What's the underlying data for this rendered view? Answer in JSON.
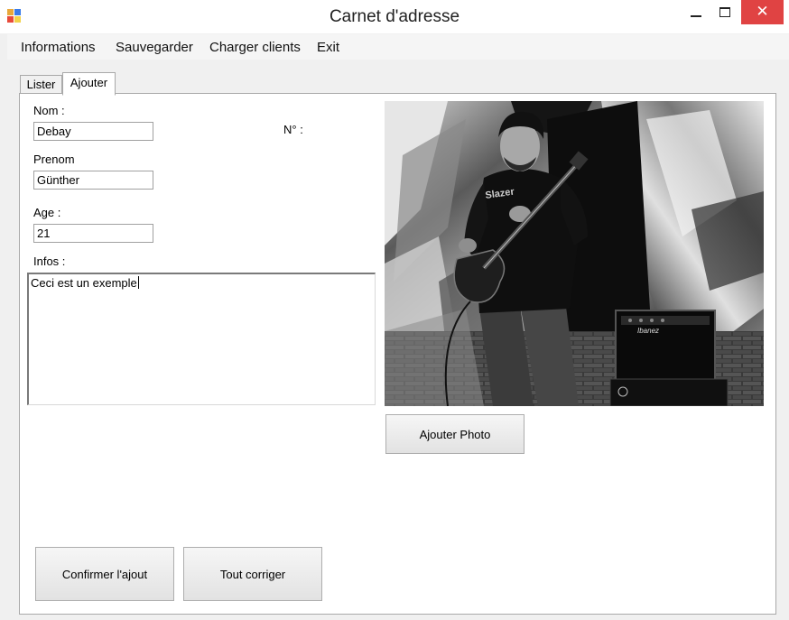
{
  "window": {
    "title": "Carnet d'adresse",
    "close_symbol": "✕",
    "icons": [
      "app-icon",
      "minimize-icon",
      "maximize-icon",
      "close-icon"
    ]
  },
  "menu": {
    "items": [
      "Informations",
      "Sauvegarder",
      "Charger clients",
      "Exit"
    ]
  },
  "tabs": {
    "items": [
      "Lister",
      "Ajouter"
    ],
    "active": "Ajouter"
  },
  "form": {
    "nom_label": "Nom :",
    "nom_value": "Debay",
    "prenom_label": "Prenom",
    "prenom_value": "Günther",
    "age_label": "Age :",
    "age_value": "21",
    "infos_label": "Infos :",
    "infos_value": "Ceci est un exemple",
    "numero_label": "N° :"
  },
  "photo": {
    "amp_text": "Ibanez",
    "shirt_text": "Slazer"
  },
  "buttons": {
    "ajouter_photo": "Ajouter Photo",
    "confirmer": "Confirmer l'ajout",
    "corriger": "Tout corriger"
  },
  "colors": {
    "close_button": "#e04343",
    "window_background": "#f0f0f0",
    "tab_background": "#ffffff"
  }
}
